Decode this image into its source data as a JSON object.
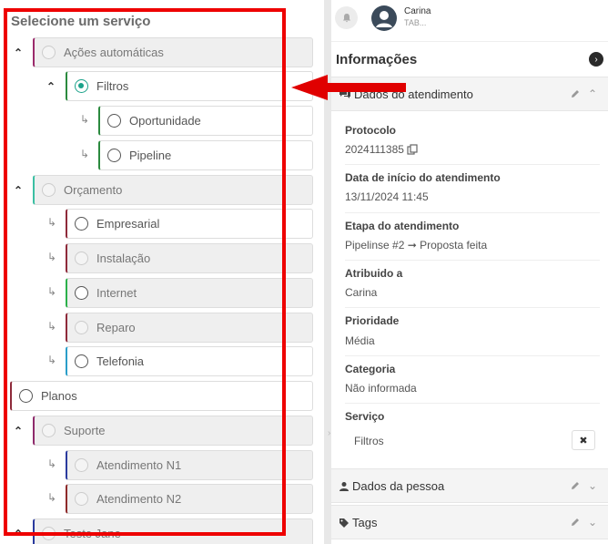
{
  "left_panel": {
    "title": "Selecione um serviço",
    "items": [
      {
        "label": "Ações automáticas",
        "accent": "#9b2a6b"
      },
      {
        "label": "Filtros",
        "accent": "#2b8a3e"
      },
      {
        "label": "Oportunidade",
        "accent": "#2b8a3e"
      },
      {
        "label": "Pipeline",
        "accent": "#2b8a3e"
      },
      {
        "label": "Orçamento",
        "accent": "#3bbfa3"
      },
      {
        "label": "Empresarial",
        "accent": "#8e2a3a"
      },
      {
        "label": "Instalação",
        "accent": "#8e2a3a"
      },
      {
        "label": "Internet",
        "accent": "#2bb04a"
      },
      {
        "label": "Reparo",
        "accent": "#8e2a3a"
      },
      {
        "label": "Telefonia",
        "accent": "#2a9ec9"
      },
      {
        "label": "Planos",
        "accent": "#8e2a3a"
      },
      {
        "label": "Suporte",
        "accent": "#8e2a6b"
      },
      {
        "label": "Atendimento N1",
        "accent": "#2a3a9e"
      },
      {
        "label": "Atendimento N2",
        "accent": "#8e2a2a"
      },
      {
        "label": "Teste Jane",
        "accent": "#2a3a9e"
      }
    ]
  },
  "user": {
    "name": "Carina",
    "subtitle": "TAB..."
  },
  "info": {
    "title": "Informações",
    "section_atendimento": "Dados do atendimento",
    "fields": [
      {
        "label": "Protocolo",
        "value": "2024111385"
      },
      {
        "label": "Data de início do atendimento",
        "value": "13/11/2024 11:45"
      },
      {
        "label": "Etapa do atendimento",
        "value": "Pipelinse #2 ➞ Proposta feita"
      },
      {
        "label": "Atribuido a",
        "value": "Carina"
      },
      {
        "label": "Prioridade",
        "value": "Média"
      },
      {
        "label": "Categoria",
        "value": "Não informada"
      },
      {
        "label": "Serviço",
        "value": "Filtros"
      }
    ],
    "section_pessoa": "Dados da pessoa",
    "section_tags": "Tags"
  },
  "colors": {
    "selected_radio": "#1ba28a",
    "highlight": "#e00000"
  }
}
